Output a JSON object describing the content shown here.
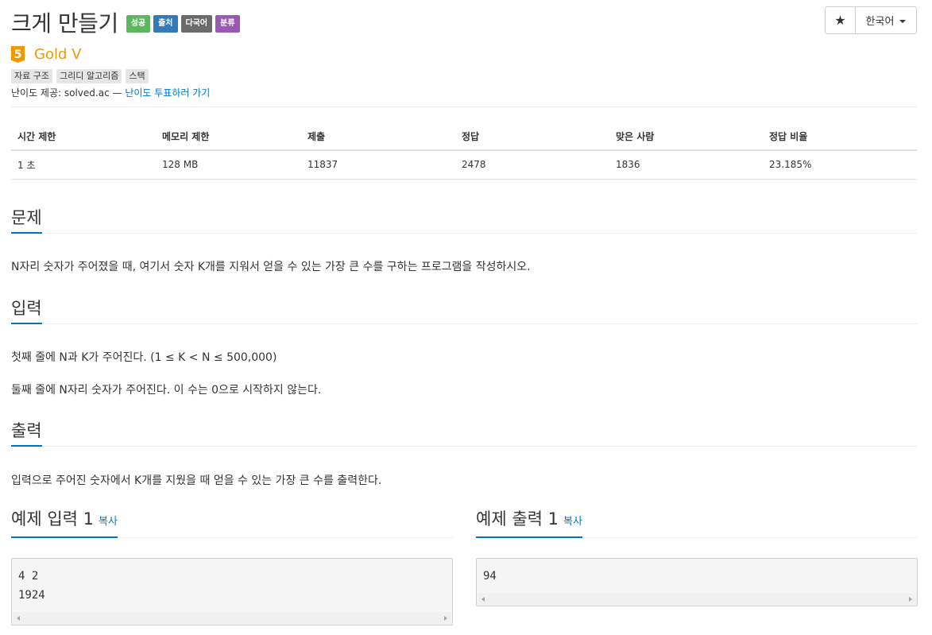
{
  "header": {
    "title": "크게 만들기",
    "labels": [
      {
        "text": "성공",
        "color": "#5cb85c"
      },
      {
        "text": "출처",
        "color": "#337ab7"
      },
      {
        "text": "다국어",
        "color": "#6b6b6b"
      },
      {
        "text": "분류",
        "color": "#9b59b6"
      }
    ],
    "star_icon": "★",
    "language": "한국어"
  },
  "tier": {
    "level": "5",
    "name": "Gold V",
    "color": "#ec9a00"
  },
  "tags": [
    "자료 구조",
    "그리디 알고리즘",
    "스택"
  ],
  "difficulty": {
    "prefix": "난이도 제공: solved.ac —",
    "link": "난이도 투표하러 가기"
  },
  "stats": {
    "headers": [
      "시간 제한",
      "메모리 제한",
      "제출",
      "정답",
      "맞은 사람",
      "정답 비율"
    ],
    "values": [
      "1 초",
      "128 MB",
      "11837",
      "2478",
      "1836",
      "23.185%"
    ]
  },
  "sections": {
    "problem": {
      "title": "문제",
      "body": "N자리 숫자가 주어졌을 때, 여기서 숫자 K개를 지워서 얻을 수 있는 가장 큰 수를 구하는 프로그램을 작성하시오."
    },
    "input": {
      "title": "입력",
      "lines": [
        "첫째 줄에 N과 K가 주어진다. (1 ≤ K < N ≤ 500,000)",
        "둘째 줄에 N자리 숫자가 주어진다. 이 수는 0으로 시작하지 않는다."
      ]
    },
    "output": {
      "title": "출력",
      "body": "입력으로 주어진 숫자에서 K개를 지웠을 때 얻을 수 있는 가장 큰 수를 출력한다."
    }
  },
  "samples": {
    "input": {
      "title": "예제 입력 1",
      "copy": "복사",
      "lines": [
        "4 2",
        "1924"
      ]
    },
    "output": {
      "title": "예제 출력 1",
      "copy": "복사",
      "lines": [
        "94"
      ]
    }
  }
}
